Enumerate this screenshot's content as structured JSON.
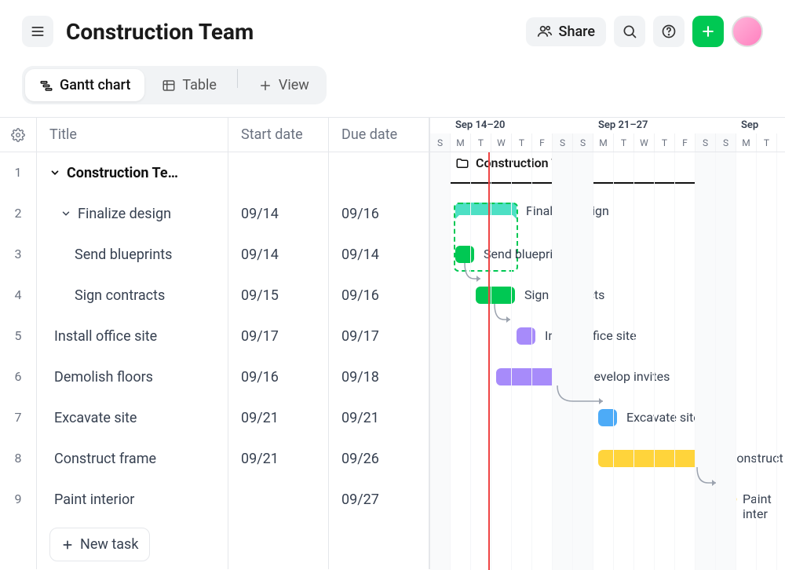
{
  "header": {
    "title": "Construction Team",
    "share_label": "Share"
  },
  "tabs": {
    "gantt": "Gantt chart",
    "table": "Table",
    "view": "View"
  },
  "columns": {
    "title": "Title",
    "start": "Start date",
    "due": "Due date"
  },
  "weeks": {
    "w1": "Sep 14–20",
    "w2": "Sep 21–27",
    "w3": "Sep"
  },
  "days": [
    "S",
    "M",
    "T",
    "W",
    "T",
    "F",
    "S",
    "S",
    "M",
    "T",
    "W",
    "T",
    "F",
    "S",
    "S",
    "M",
    "T"
  ],
  "rows": [
    {
      "num": "1",
      "title": "Construction Te…",
      "start": "",
      "due": ""
    },
    {
      "num": "2",
      "title": "Finalize design",
      "start": "09/14",
      "due": "09/16"
    },
    {
      "num": "3",
      "title": "Send blueprints",
      "start": "09/14",
      "due": "09/14"
    },
    {
      "num": "4",
      "title": "Sign contracts",
      "start": "09/15",
      "due": "09/16"
    },
    {
      "num": "5",
      "title": "Install office site",
      "start": "09/17",
      "due": "09/17"
    },
    {
      "num": "6",
      "title": "Demolish floors",
      "start": "09/16",
      "due": "09/18"
    },
    {
      "num": "7",
      "title": "Excavate site",
      "start": "09/21",
      "due": "09/21"
    },
    {
      "num": "8",
      "title": "Construct frame",
      "start": "09/21",
      "due": "09/26"
    },
    {
      "num": "9",
      "title": "Paint interior",
      "start": "",
      "due": "09/27"
    }
  ],
  "gantt_labels": {
    "project": "Construction Team",
    "r2": "Finalize design",
    "r3": "Send blueprints",
    "r4": "Sign contracts",
    "r5": "Install office site",
    "r6": "Develop invites",
    "r7": "Excavate site",
    "r8": "Construct fra",
    "r9": "Paint inter"
  },
  "new_task": "New task",
  "colors": {
    "teal": "#4de0c4",
    "green": "#00c853",
    "purple": "#a78bfa",
    "blue": "#4dabf7",
    "yellow": "#ffd43b"
  }
}
